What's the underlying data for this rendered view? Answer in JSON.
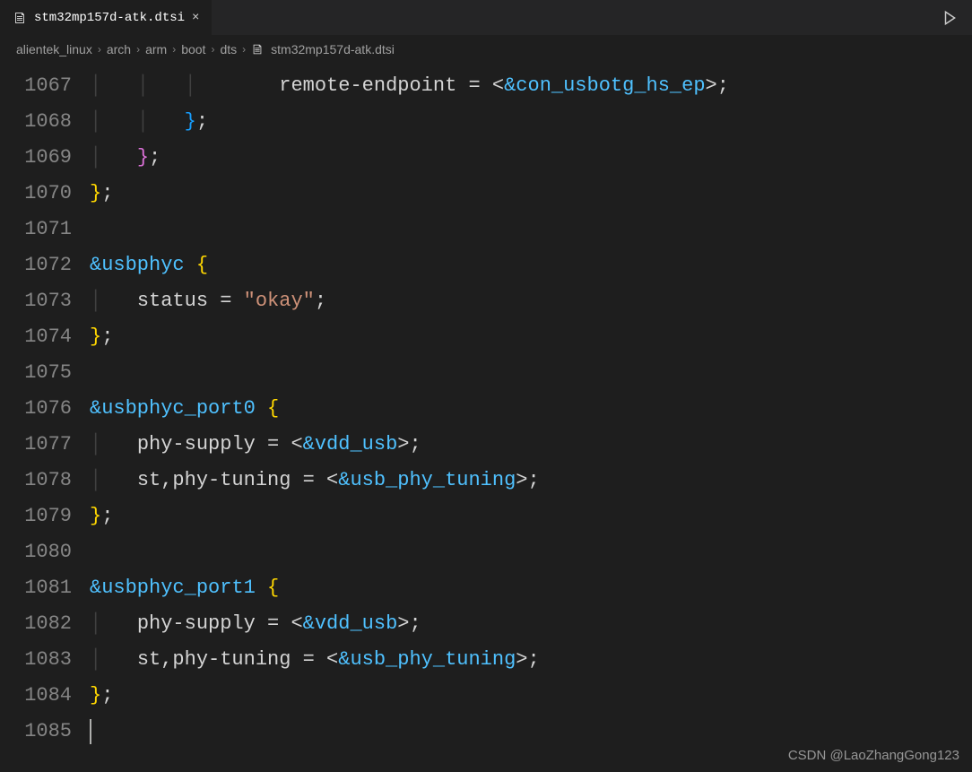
{
  "tab": {
    "filename": "stm32mp157d-atk.dtsi",
    "close_symbol": "×"
  },
  "breadcrumbs": {
    "items": [
      "alientek_linux",
      "arch",
      "arm",
      "boot",
      "dts"
    ],
    "file": "stm32mp157d-atk.dtsi"
  },
  "gutter": {
    "start": 1067,
    "end": 1085
  },
  "code": {
    "lines": [
      {
        "n": 1067,
        "tokens": [
          {
            "t": "guide",
            "v": "│   │   │   "
          },
          {
            "t": "text",
            "v": "    remote-endpoint = <"
          },
          {
            "t": "ref",
            "v": "&con_usbotg_hs_ep"
          },
          {
            "t": "text",
            "v": ">;"
          }
        ]
      },
      {
        "n": 1068,
        "tokens": [
          {
            "t": "guide",
            "v": "│   │   "
          },
          {
            "t": "brace3",
            "v": "}"
          },
          {
            "t": "text",
            "v": ";"
          }
        ]
      },
      {
        "n": 1069,
        "tokens": [
          {
            "t": "guide",
            "v": "│   "
          },
          {
            "t": "brace2",
            "v": "}"
          },
          {
            "t": "text",
            "v": ";"
          }
        ]
      },
      {
        "n": 1070,
        "tokens": [
          {
            "t": "brace",
            "v": "}"
          },
          {
            "t": "text",
            "v": ";"
          }
        ]
      },
      {
        "n": 1071,
        "tokens": []
      },
      {
        "n": 1072,
        "tokens": [
          {
            "t": "ref",
            "v": "&usbphyc"
          },
          {
            "t": "text",
            "v": " "
          },
          {
            "t": "brace",
            "v": "{"
          }
        ]
      },
      {
        "n": 1073,
        "tokens": [
          {
            "t": "guide",
            "v": "│   "
          },
          {
            "t": "text",
            "v": "status = "
          },
          {
            "t": "string",
            "v": "\"okay\""
          },
          {
            "t": "text",
            "v": ";"
          }
        ]
      },
      {
        "n": 1074,
        "tokens": [
          {
            "t": "brace",
            "v": "}"
          },
          {
            "t": "text",
            "v": ";"
          }
        ]
      },
      {
        "n": 1075,
        "tokens": []
      },
      {
        "n": 1076,
        "tokens": [
          {
            "t": "ref",
            "v": "&usbphyc_port0"
          },
          {
            "t": "text",
            "v": " "
          },
          {
            "t": "brace",
            "v": "{"
          }
        ]
      },
      {
        "n": 1077,
        "tokens": [
          {
            "t": "guide",
            "v": "│   "
          },
          {
            "t": "text",
            "v": "phy-supply = <"
          },
          {
            "t": "ref",
            "v": "&vdd_usb"
          },
          {
            "t": "text",
            "v": ">;"
          }
        ]
      },
      {
        "n": 1078,
        "tokens": [
          {
            "t": "guide",
            "v": "│   "
          },
          {
            "t": "text",
            "v": "st,phy-tuning = <"
          },
          {
            "t": "ref",
            "v": "&usb_phy_tuning"
          },
          {
            "t": "text",
            "v": ">;"
          }
        ]
      },
      {
        "n": 1079,
        "tokens": [
          {
            "t": "brace",
            "v": "}"
          },
          {
            "t": "text",
            "v": ";"
          }
        ]
      },
      {
        "n": 1080,
        "tokens": []
      },
      {
        "n": 1081,
        "tokens": [
          {
            "t": "ref",
            "v": "&usbphyc_port1"
          },
          {
            "t": "text",
            "v": " "
          },
          {
            "t": "brace",
            "v": "{"
          }
        ]
      },
      {
        "n": 1082,
        "tokens": [
          {
            "t": "guide",
            "v": "│   "
          },
          {
            "t": "text",
            "v": "phy-supply = <"
          },
          {
            "t": "ref",
            "v": "&vdd_usb"
          },
          {
            "t": "text",
            "v": ">;"
          }
        ]
      },
      {
        "n": 1083,
        "tokens": [
          {
            "t": "guide",
            "v": "│   "
          },
          {
            "t": "text",
            "v": "st,phy-tuning = <"
          },
          {
            "t": "ref",
            "v": "&usb_phy_tuning"
          },
          {
            "t": "text",
            "v": ">;"
          }
        ]
      },
      {
        "n": 1084,
        "tokens": [
          {
            "t": "brace",
            "v": "}"
          },
          {
            "t": "text",
            "v": ";"
          }
        ]
      },
      {
        "n": 1085,
        "tokens": []
      }
    ]
  },
  "watermark": "CSDN @LaoZhangGong123"
}
